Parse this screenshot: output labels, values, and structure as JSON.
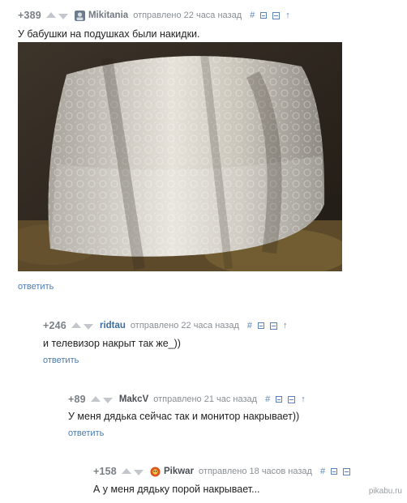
{
  "comments": [
    {
      "rating": "+389",
      "author": "Mikitania",
      "sent": "отправлено 22 часа назад",
      "text": "У бабушки на подушках были накидки.",
      "reply": "ответить"
    },
    {
      "rating": "+246",
      "author": "ridtau",
      "sent": "отправлено 22 часа назад",
      "text": "и телевизор накрыт так же_))",
      "reply": "ответить"
    },
    {
      "rating": "+89",
      "author": "MakcV",
      "sent": "отправлено 21 час назад",
      "text": "У меня дядька сейчас так и монитор накрывает))",
      "reply": "ответить"
    },
    {
      "rating": "+158",
      "author": "Pikwar",
      "sent": "отправлено 18 часов назад",
      "text": "А у меня дядьку порой накрывает..."
    }
  ],
  "controls": {
    "link_symbol": "#",
    "parent_symbol": "↑"
  },
  "watermark": "pikabu.ru",
  "colors": {
    "link_blue": "#4b7bb0",
    "rating_gray": "#7a7f86",
    "vote_arrow": "#c3c7cc"
  },
  "icons": [
    "vote-up-icon",
    "vote-down-icon",
    "collapse-icon",
    "save-icon",
    "parent-arrow-icon",
    "avatar-icon"
  ]
}
